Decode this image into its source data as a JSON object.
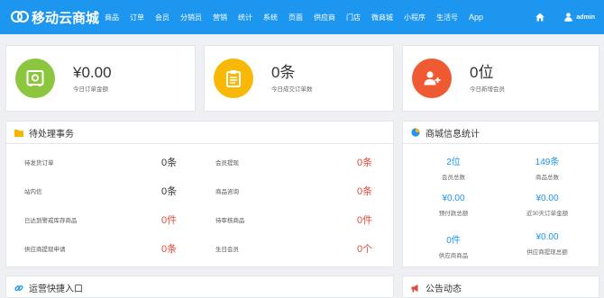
{
  "brand": {
    "name": "移动云商城"
  },
  "nav": {
    "items": [
      "商品",
      "订单",
      "会员",
      "分销员",
      "营销",
      "统计",
      "系统",
      "页面",
      "供应商",
      "门店",
      "微商城",
      "小程序",
      "生活号",
      "App"
    ],
    "user": "admin"
  },
  "cards": [
    {
      "value": "¥0.00",
      "label": "今日订单金额",
      "color": "#8cc63f",
      "icon": "safe-icon"
    },
    {
      "value": "0条",
      "label": "今日成交订单数",
      "color": "#f9b805",
      "icon": "clipboard-icon"
    },
    {
      "value": "0位",
      "label": "今日新增会员",
      "color": "#f05a32",
      "icon": "add-user-icon"
    }
  ],
  "pending": {
    "title": "待处理事务",
    "rows": [
      {
        "label1": "待发货订单",
        "value1": "0条",
        "label2": "会员提现",
        "value2": "0条"
      },
      {
        "label1": "站内信",
        "value1": "0条",
        "label2": "商品咨询",
        "value2": "0条"
      },
      {
        "label1": "已达到警戒库存商品",
        "value1": "0件",
        "label2": "待审核商品",
        "value2": "0件"
      },
      {
        "label1": "供应商提现申请",
        "value1": "0条",
        "label2": "生日会员",
        "value2": "0个"
      }
    ]
  },
  "mall_stats": {
    "title": "商城信息统计",
    "items": [
      {
        "value": "2位",
        "label": "会员总数"
      },
      {
        "value": "149条",
        "label": "商品总数"
      },
      {
        "value": "¥0.00",
        "label": "预付款总额"
      },
      {
        "value": "¥0.00",
        "label": "近30天订单金额"
      },
      {
        "value": "0件",
        "label": "供应商商品"
      },
      {
        "value": "¥0.00",
        "label": "供应商提现总额"
      }
    ]
  },
  "shortcuts": {
    "title": "运营快捷入口"
  },
  "announcements": {
    "title": "公告动态"
  },
  "colors": {
    "primary": "#1d96f0",
    "danger": "#e04b3a"
  }
}
